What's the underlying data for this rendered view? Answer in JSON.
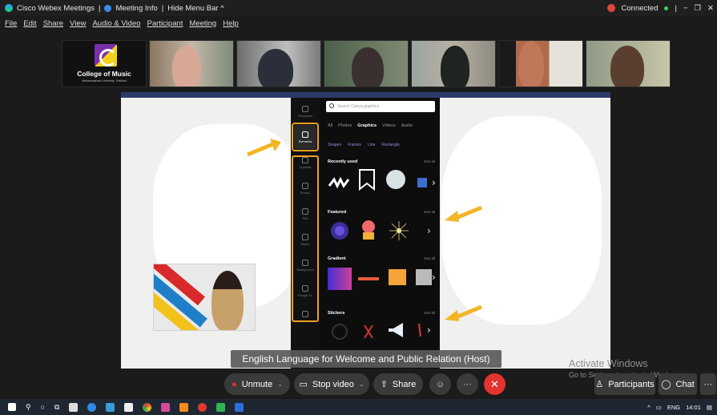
{
  "titlebar": {
    "app_title": "Cisco Webex Meetings",
    "sep1": "|",
    "meeting_info": "Meeting Info",
    "sep2": "|",
    "hide_menu": "Hide Menu Bar ^",
    "connected": "Connected",
    "sep3": "|",
    "minimize": "−",
    "restore": "❐",
    "close": "✕"
  },
  "menu": {
    "items": [
      "File",
      "Edit",
      "Share",
      "View",
      "Audio & Video",
      "Participant",
      "Meeting",
      "Help"
    ]
  },
  "participants_strip": {
    "logo_title": "College of Music",
    "logo_subtitle": "Mahasarakham University, Thailand"
  },
  "shared_content": {
    "search_placeholder": "Search Canva graphics",
    "tabs": [
      "All",
      "Photos",
      "Graphics",
      "Videos",
      "Audio"
    ],
    "active_tab": "Graphics",
    "chips": [
      "Shapes",
      "Frames",
      "Line",
      "Rectangle"
    ],
    "rail": [
      "Templates",
      "Elements",
      "Uploads",
      "Photos",
      "Text",
      "Styles",
      "Background",
      "Google Dr.",
      "More"
    ],
    "sections": [
      "Recently used",
      "Featured",
      "Gradient",
      "Stickers"
    ],
    "see_all": "See all"
  },
  "caption": "English Language for Welcome and Public Relation (Host)",
  "watermark": {
    "line1": "Activate Windows",
    "line2": "Go to Settings to activate Windows."
  },
  "controls": {
    "unmute": "Unmute",
    "stop_video": "Stop video",
    "share": "Share",
    "participants": "Participants",
    "chat": "Chat",
    "more": "···"
  },
  "taskbar": {
    "language": "ENG",
    "time": "14:01"
  },
  "colors": {
    "end_button": "#e3342f",
    "accent_orange": "#f0a020",
    "connected_dot": "#e0453b"
  }
}
